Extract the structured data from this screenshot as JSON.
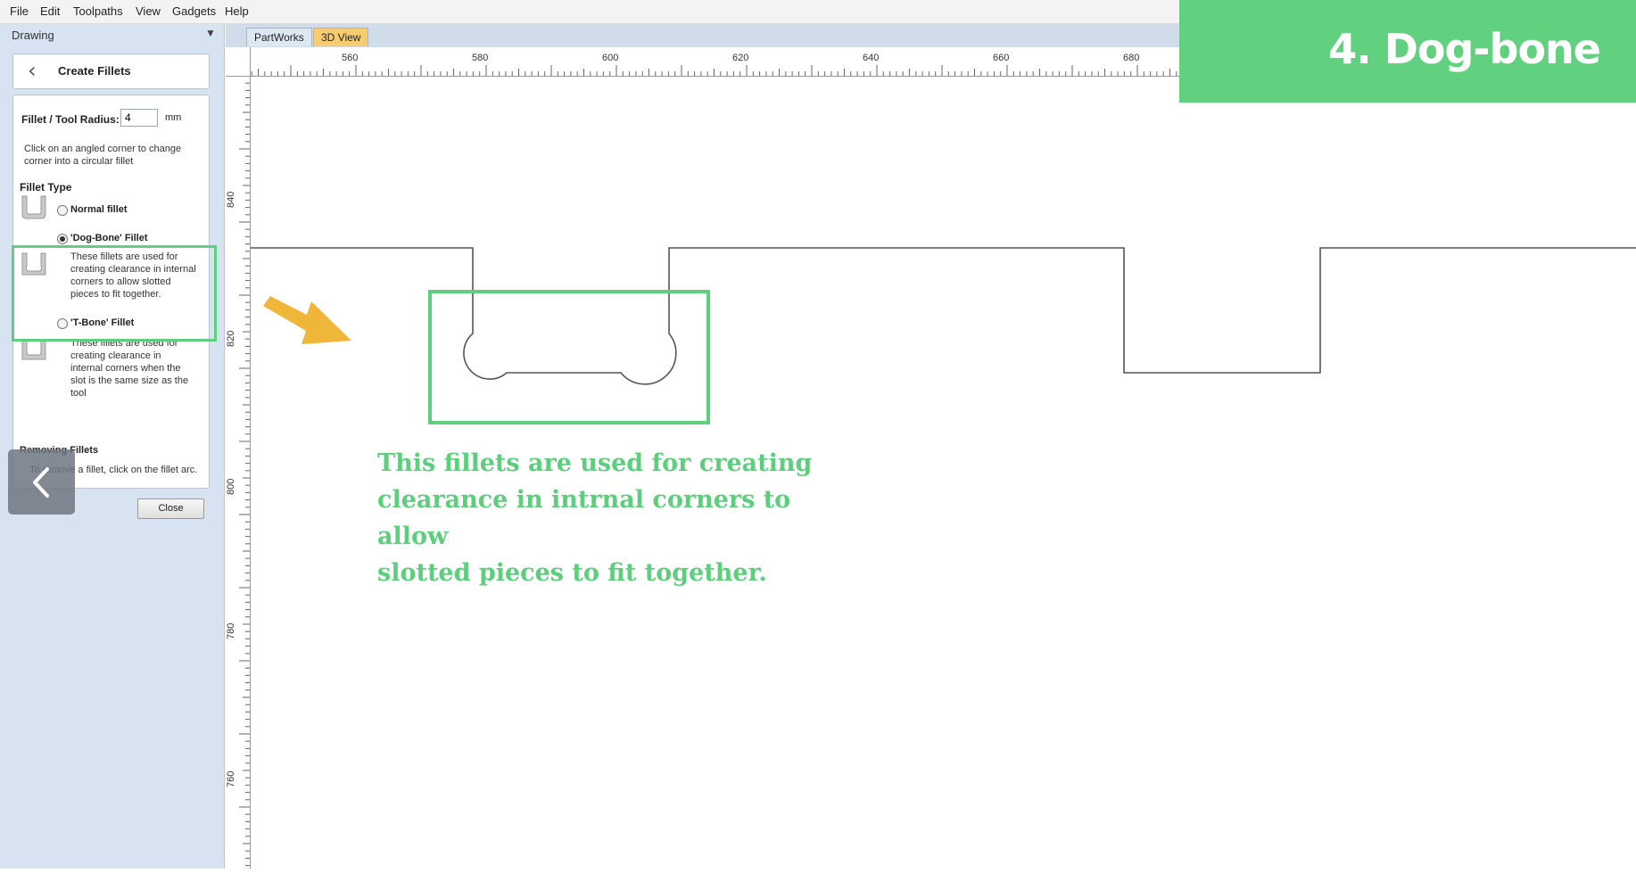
{
  "menu": [
    "File",
    "Edit",
    "Toolpaths",
    "View",
    "Gadgets",
    "Help"
  ],
  "panel": {
    "title": "Drawing",
    "header_title": "Create Fillets",
    "radius_label": "Fillet / Tool Radius:",
    "radius_value": "4",
    "radius_unit": "mm",
    "instruction_line1": "Click on an angled corner to change",
    "instruction_line2": "corner into a circular fillet",
    "fillet_type_heading": "Fillet Type",
    "options": [
      {
        "label": "Normal fillet",
        "selected": false,
        "desc": []
      },
      {
        "label": "'Dog-Bone' Fillet",
        "selected": true,
        "desc": [
          "These fillets are used for",
          "creating clearance in internal",
          "corners to allow slotted",
          "pieces to fit together."
        ]
      },
      {
        "label": "'T-Bone' Fillet",
        "selected": false,
        "desc": [
          "These fillets are used for",
          "creating clearance in",
          "internal corners when the",
          "slot is the same size as the",
          "tool"
        ]
      }
    ],
    "removing_heading": "Removing Fillets",
    "removing_text": "To remove a fillet, click on the fillet arc.",
    "close_label": "Close"
  },
  "tabs": [
    "PartWorks",
    "3D View"
  ],
  "ruler": {
    "top_labels": [
      "560",
      "580",
      "600",
      "620",
      "640",
      "660",
      "680"
    ],
    "left_labels": [
      "840",
      "820",
      "800",
      "780",
      "760"
    ]
  },
  "annotation": [
    "This fillets are used for creating",
    "clearance in intrnal corners to allow",
    "slotted pieces to fit together."
  ],
  "banner_title": "4. Dog-bone",
  "colors": {
    "highlight": "#5fcf7f",
    "banner": "#62d17f",
    "arrow": "#f0b63a",
    "tab_3d": "#f5cd70",
    "panel_bg": "#d7e3f0"
  }
}
